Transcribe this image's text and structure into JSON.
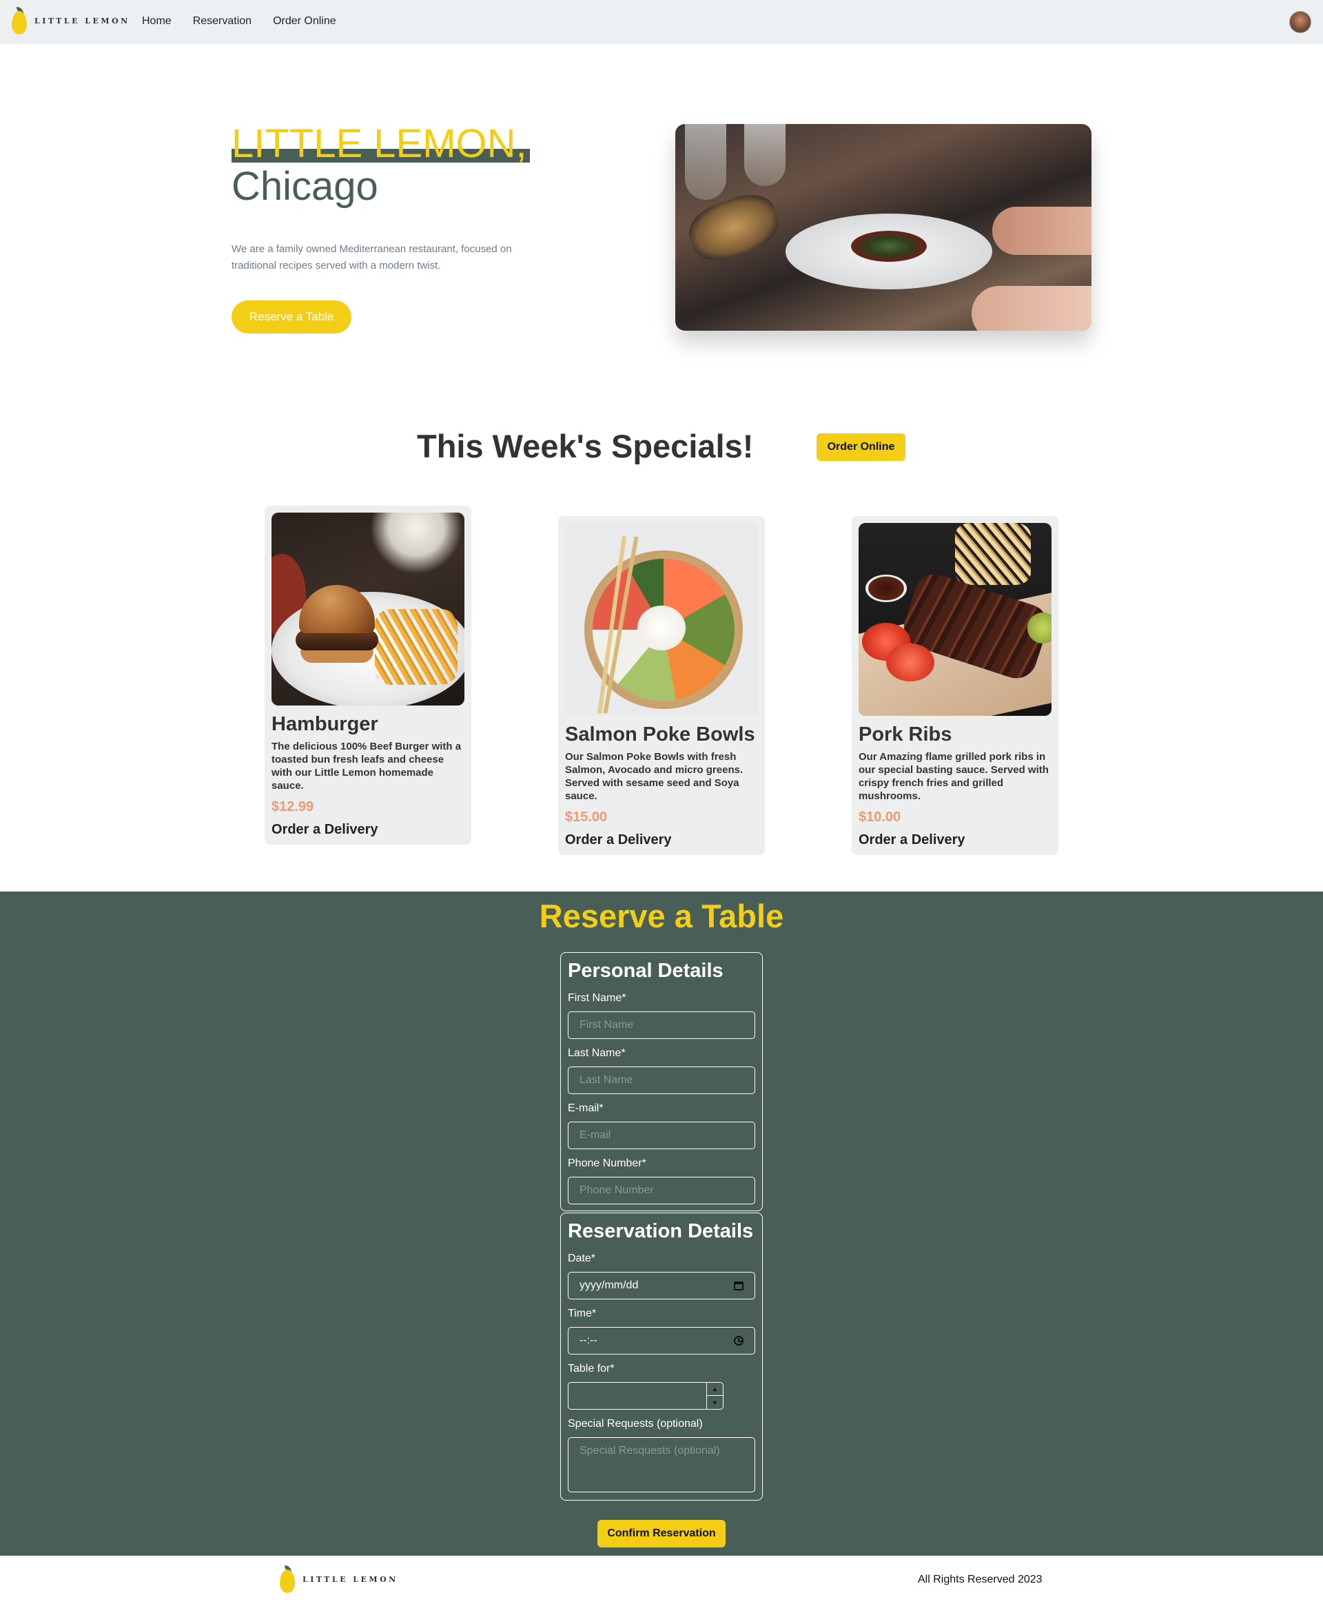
{
  "nav": {
    "logo_text": "LITTLE LEMON",
    "links": [
      "Home",
      "Reservation",
      "Order Online"
    ]
  },
  "hero": {
    "title_line1": "LITTLE LEMON,",
    "title_line2": "Chicago",
    "description": "We are a family owned Mediterranean restaurant, focused on traditional recipes served with a modern twist.",
    "button": "Reserve a Table"
  },
  "specials": {
    "title": "This Week's Specials!",
    "order_online": "Order Online",
    "cards": [
      {
        "name": "Hamburger",
        "description": "The delicious 100% Beef Burger with a toasted bun fresh leafs and cheese with our Little Lemon homemade sauce.",
        "price": "$12.99",
        "action": "Order a Delivery"
      },
      {
        "name": "Salmon Poke Bowls",
        "description": "Our Salmon Poke Bowls with fresh Salmon, Avocado and micro greens. Served with sesame seed and Soya sauce.",
        "price": "$15.00",
        "action": "Order a Delivery"
      },
      {
        "name": "Pork Ribs",
        "description": "Our Amazing flame grilled pork ribs in our special basting sauce. Served with crispy french fries and grilled mushrooms.",
        "price": "$10.00",
        "action": "Order a Delivery"
      }
    ]
  },
  "reserve": {
    "title": "Reserve a Table",
    "personal": {
      "legend": "Personal Details",
      "first_name_label": "First Name*",
      "first_name_placeholder": "First Name",
      "last_name_label": "Last Name*",
      "last_name_placeholder": "Last Name",
      "email_label": "E-mail*",
      "email_placeholder": "E-mail",
      "phone_label": "Phone Number*",
      "phone_placeholder": "Phone Number"
    },
    "reservation": {
      "legend": "Reservation Details",
      "date_label": "Date*",
      "date_value": "yyyy/mm/dd",
      "time_label": "Time*",
      "time_value": "--:--",
      "table_label": "Table for*",
      "requests_label": "Special Requests (optional)",
      "requests_placeholder": "Special Resquests (optional)"
    },
    "confirm": "Confirm Reservation"
  },
  "footer": {
    "logo_text": "LITTLE LEMON",
    "copyright": "All Rights Reserved 2023"
  },
  "colors": {
    "primary_green": "#495e57",
    "primary_yellow": "#f4ce14",
    "accent_salmon": "#ee9972",
    "card_bg": "#edeeee",
    "nav_bg": "#edf0f3"
  },
  "icons": [
    "lemon-logo-icon",
    "user-avatar",
    "calendar-icon",
    "clock-icon",
    "spinner-up-icon",
    "spinner-down-icon"
  ]
}
